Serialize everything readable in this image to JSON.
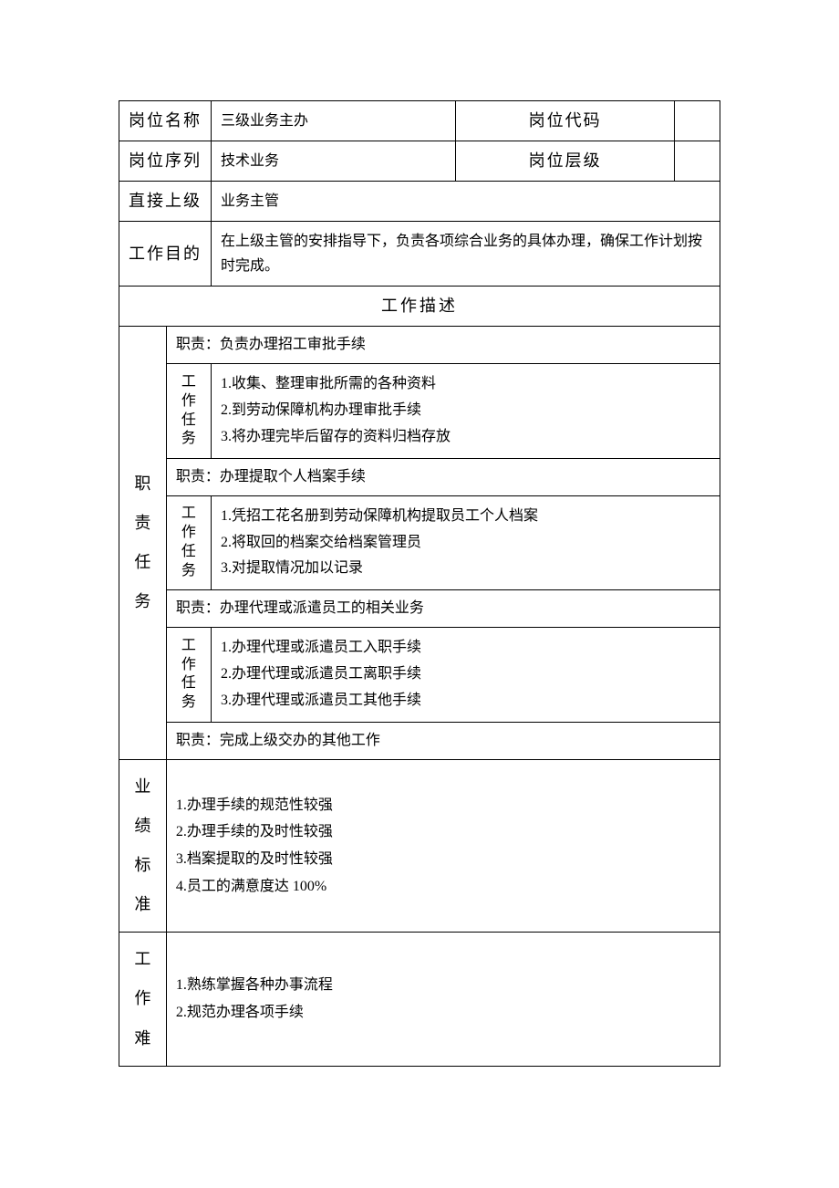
{
  "header": {
    "positionNameLabel": "岗位名称",
    "positionNameValue": "三级业务主办",
    "positionCodeLabel": "岗位代码",
    "positionCodeValue": "",
    "positionSeriesLabel": "岗位序列",
    "positionSeriesValue": "技术业务",
    "positionLevelLabel": "岗位层级",
    "positionLevelValue": "",
    "directSuperiorLabel": "直接上级",
    "directSuperiorValue": "业务主管",
    "workPurposeLabel": "工作目的",
    "workPurposeValue": "在上级主管的安排指导下，负责各项综合业务的具体办理，确保工作计划按时完成。"
  },
  "sectionTitle": "工作描述",
  "sideLabels": {
    "dutiesTasks": "职责任务",
    "performance": "业绩标准",
    "difficulty": "工作难",
    "taskLabel": "工作任务"
  },
  "duties": [
    {
      "title": "职责：负责办理招工审批手续",
      "tasks": [
        "1.收集、整理审批所需的各种资料",
        "2.到劳动保障机构办理审批手续",
        "3.将办理完毕后留存的资料归档存放"
      ]
    },
    {
      "title": "职责：办理提取个人档案手续",
      "tasks": [
        "1.凭招工花名册到劳动保障机构提取员工个人档案",
        "2.将取回的档案交给档案管理员",
        "3.对提取情况加以记录"
      ]
    },
    {
      "title": "职责：办理代理或派遣员工的相关业务",
      "tasks": [
        "1.办理代理或派遣员工入职手续",
        "2.办理代理或派遣员工离职手续",
        "3.办理代理或派遣员工其他手续"
      ]
    },
    {
      "title": "职责：完成上级交办的其他工作",
      "tasks": []
    }
  ],
  "performanceStandards": [
    "1.办理手续的规范性较强",
    "2.办理手续的及时性较强",
    "3.档案提取的及时性较强",
    "4.员工的满意度达 100%"
  ],
  "workDifficulties": [
    "1.熟练掌握各种办事流程",
    "2.规范办理各项手续"
  ]
}
